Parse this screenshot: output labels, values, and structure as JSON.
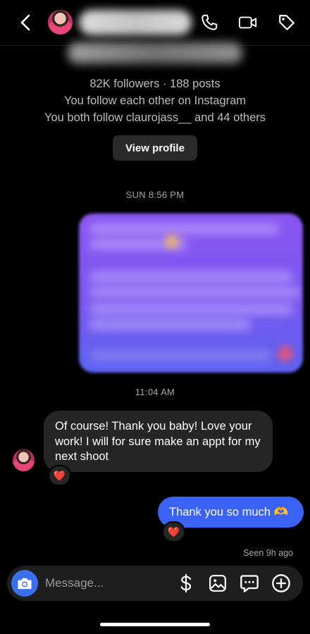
{
  "header": {
    "back_icon": "chevron-left-icon",
    "call_icon": "phone-icon",
    "video_icon": "video-camera-icon",
    "tag_icon": "tag-icon"
  },
  "profile": {
    "followers_posts": "82K followers · 188 posts",
    "mutual_line": "You follow each other on Instagram",
    "followed_by": "You both follow claurojass__ and 44 others",
    "view_profile_label": "View profile"
  },
  "thread": {
    "timestamp_1": "SUN 8:56 PM",
    "timestamp_2": "11:04 AM",
    "received_message": "Of course!  Thank you baby! Love your work! I will for sure make an appt for my next shoot",
    "received_reaction": "❤️",
    "sent_message": "Thank you so much 🫶",
    "sent_reaction": "❤️",
    "seen_status": "Seen 9h ago"
  },
  "composer": {
    "placeholder": "Message...",
    "camera_icon": "camera-icon",
    "dollar_icon": "dollar-icon",
    "gallery_icon": "image-icon",
    "chat_icon": "chat-bubble-icon",
    "plus_icon": "plus-circle-icon"
  },
  "colors": {
    "background": "#000000",
    "sent_bubble": "#3a63f5",
    "received_bubble": "#262626",
    "accent_blue": "#3a70f0",
    "heart": "#e0245e"
  }
}
